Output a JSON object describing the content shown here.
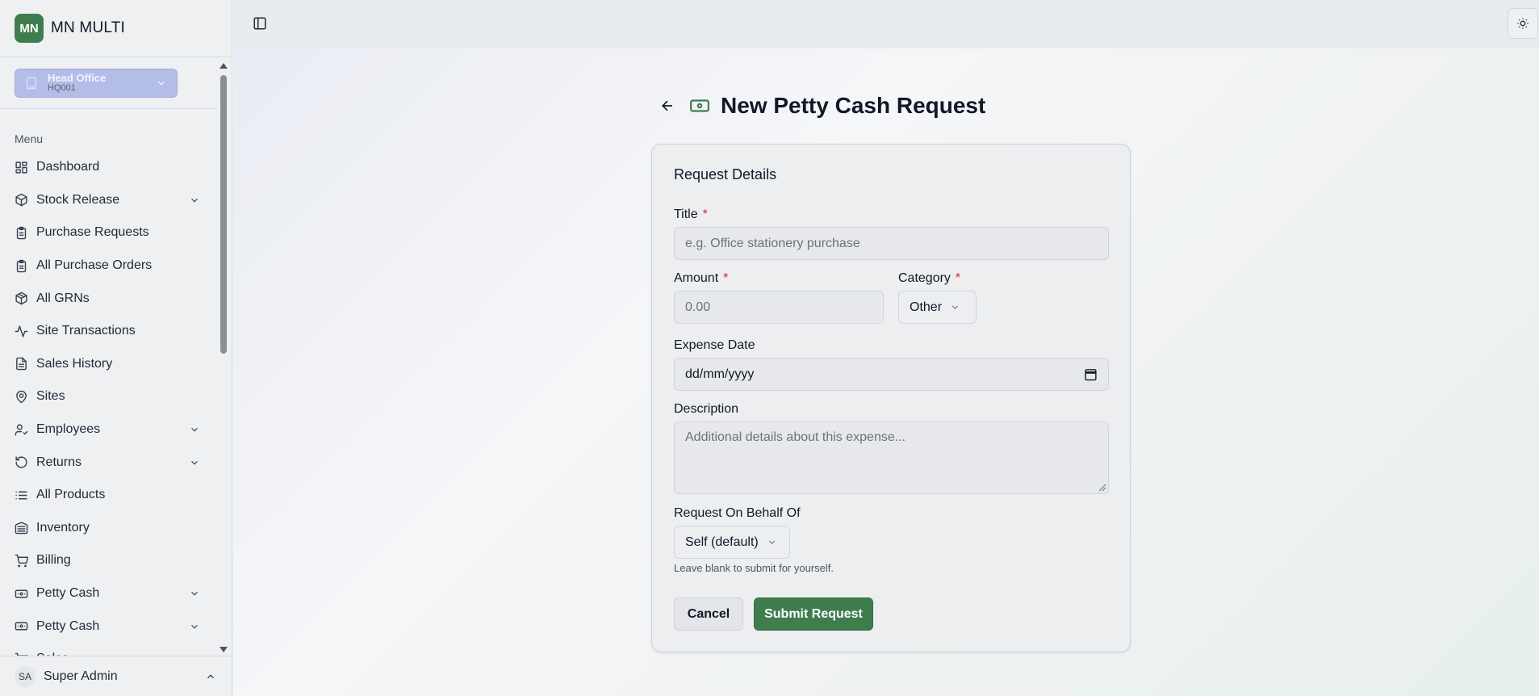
{
  "app": {
    "logo_text": "MN",
    "name": "MN MULTI"
  },
  "branch": {
    "name": "Head Office",
    "code": "HQ001"
  },
  "sidebar": {
    "menu_label": "Menu",
    "items": [
      {
        "label": "Dashboard",
        "icon": "dashboard-icon",
        "expandable": false
      },
      {
        "label": "Stock Release",
        "icon": "box-icon",
        "expandable": true
      },
      {
        "label": "Purchase Requests",
        "icon": "clipboard-icon",
        "expandable": false
      },
      {
        "label": "All Purchase Orders",
        "icon": "clipboard-icon",
        "expandable": false
      },
      {
        "label": "All GRNs",
        "icon": "package-icon",
        "expandable": false
      },
      {
        "label": "Site Transactions",
        "icon": "activity-icon",
        "expandable": false
      },
      {
        "label": "Sales History",
        "icon": "file-text-icon",
        "expandable": false
      },
      {
        "label": "Sites",
        "icon": "map-pin-icon",
        "expandable": false
      },
      {
        "label": "Employees",
        "icon": "user-check-icon",
        "expandable": true
      },
      {
        "label": "Returns",
        "icon": "rotate-ccw-icon",
        "expandable": true
      },
      {
        "label": "All Products",
        "icon": "list-icon",
        "expandable": false
      },
      {
        "label": "Inventory",
        "icon": "warehouse-icon",
        "expandable": false
      },
      {
        "label": "Billing",
        "icon": "cart-icon",
        "expandable": false
      },
      {
        "label": "Petty Cash",
        "icon": "banknote-icon",
        "expandable": true
      },
      {
        "label": "Petty Cash",
        "icon": "banknote-icon",
        "expandable": true
      },
      {
        "label": "Sales",
        "icon": "cart-icon",
        "expandable": false
      }
    ]
  },
  "user": {
    "initials": "SA",
    "name": "Super Admin"
  },
  "page": {
    "title": "New Petty Cash Request"
  },
  "form": {
    "section_title": "Request Details",
    "title_label": "Title",
    "title_placeholder": "e.g. Office stationery purchase",
    "amount_label": "Amount",
    "amount_placeholder": "0.00",
    "category_label": "Category",
    "category_value": "Other",
    "expense_date_label": "Expense Date",
    "expense_date_placeholder": "dd/mm/yyyy",
    "description_label": "Description",
    "description_placeholder": "Additional details about this expense...",
    "behalf_label": "Request On Behalf Of",
    "behalf_value": "Self (default)",
    "behalf_hint": "Leave blank to submit for yourself.",
    "required_marker": "*",
    "cancel_label": "Cancel",
    "submit_label": "Submit Request"
  },
  "colors": {
    "brand": "#3f7d4f",
    "required": "#dc2626",
    "branch_bg": "#b4bde8"
  }
}
